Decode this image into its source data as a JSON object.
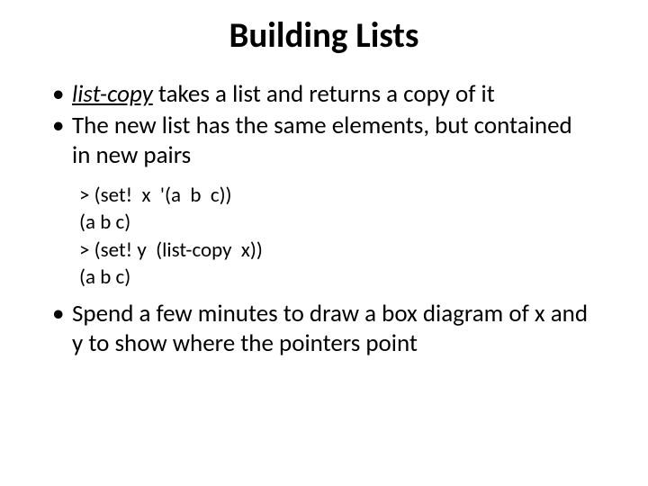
{
  "title": "Building Lists",
  "bullets": {
    "b1_underline": "list-copy",
    "b1_rest": " takes a list and returns a copy of it",
    "b2": "The new list has the same elements, but contained in new pairs",
    "b3": "Spend a few minutes to draw a box diagram of x and y to show where the pointers point"
  },
  "code": {
    "l1": "> (set!  x  '(a  b  c))",
    "l2": "(a b c)",
    "l3": "> (set! y  (list-copy  x))",
    "l4": "(a b c)"
  }
}
